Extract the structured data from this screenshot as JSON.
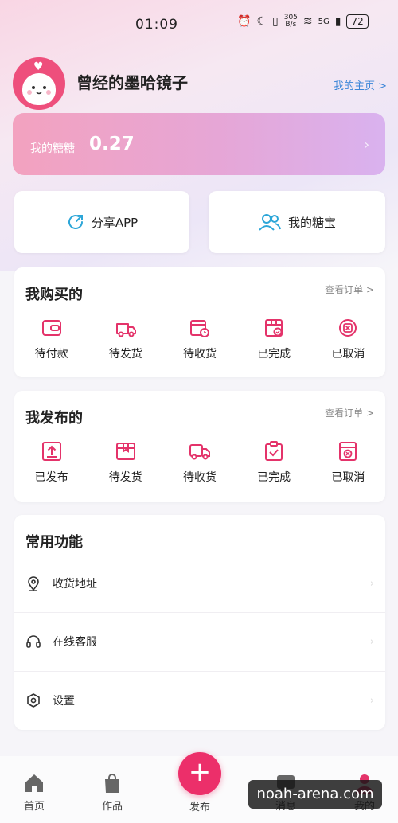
{
  "status_bar": {
    "time": "01:09",
    "net_speed_top": "305",
    "net_speed_bottom": "B/s",
    "signal": "5G",
    "battery": "72"
  },
  "profile": {
    "username": "曾经的墨哈镜子",
    "home_link": "我的主页 >"
  },
  "sugar": {
    "label": "我的糖糖",
    "value": "0.27",
    "arrow": "›"
  },
  "quick": {
    "share_label": "分享APP",
    "treasure_label": "我的糖宝"
  },
  "bought": {
    "title": "我购买的",
    "more": "查看订单 >",
    "items": [
      {
        "label": "待付款",
        "icon": "wallet-icon"
      },
      {
        "label": "待发货",
        "icon": "shipping-truck-icon"
      },
      {
        "label": "待收货",
        "icon": "clock-box-icon"
      },
      {
        "label": "已完成",
        "icon": "completed-box-icon"
      },
      {
        "label": "已取消",
        "icon": "cancel-circle-icon"
      }
    ]
  },
  "published": {
    "title": "我发布的",
    "more": "查看订单 >",
    "items": [
      {
        "label": "已发布",
        "icon": "upload-icon"
      },
      {
        "label": "待发货",
        "icon": "package-icon"
      },
      {
        "label": "待收货",
        "icon": "delivery-truck-icon"
      },
      {
        "label": "已完成",
        "icon": "clipboard-check-icon"
      },
      {
        "label": "已取消",
        "icon": "cancel-box-icon"
      }
    ]
  },
  "tools": {
    "title": "常用功能",
    "items": [
      {
        "label": "收货地址",
        "icon": "location-pin-icon"
      },
      {
        "label": "在线客服",
        "icon": "headset-icon"
      },
      {
        "label": "设置",
        "icon": "settings-icon"
      }
    ]
  },
  "tabbar": {
    "home": "首页",
    "works": "作品",
    "publish": "发布",
    "messages": "消息",
    "mine": "我的"
  },
  "watermark": "noah-arena.com",
  "colors": {
    "accent": "#ec2f6a",
    "link": "#3c86d8"
  }
}
